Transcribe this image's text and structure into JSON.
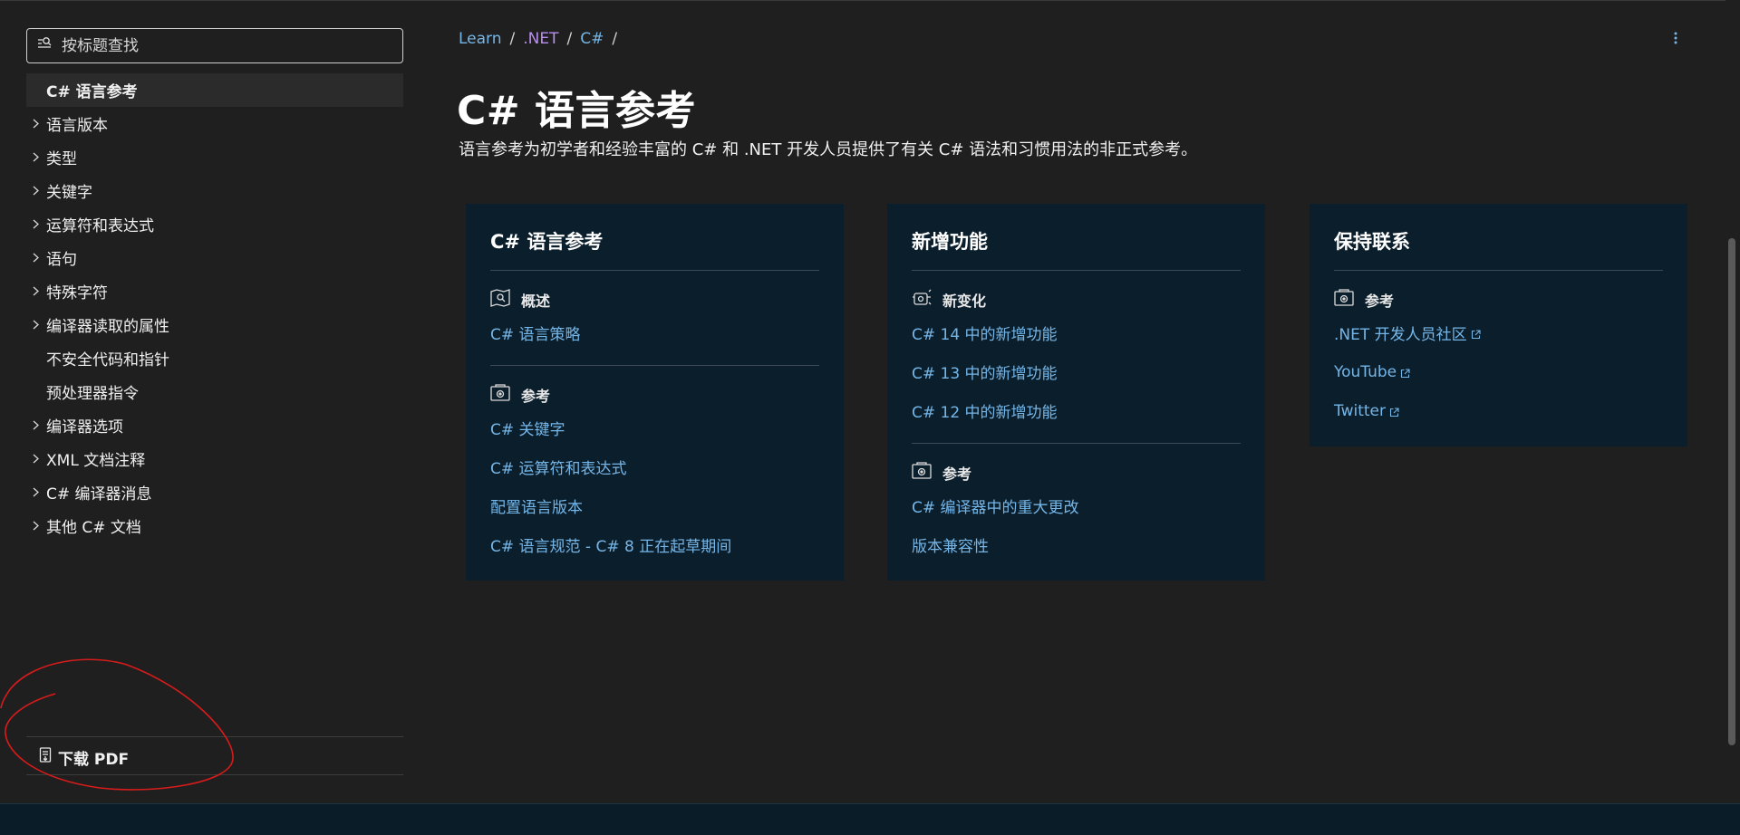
{
  "sidebar": {
    "filter_placeholder": "按标题查找",
    "items": [
      {
        "label": "C# 语言参考",
        "expandable": false,
        "active": true
      },
      {
        "label": "语言版本",
        "expandable": true
      },
      {
        "label": "类型",
        "expandable": true
      },
      {
        "label": "关键字",
        "expandable": true
      },
      {
        "label": "运算符和表达式",
        "expandable": true
      },
      {
        "label": "语句",
        "expandable": true
      },
      {
        "label": "特殊字符",
        "expandable": true
      },
      {
        "label": "编译器读取的属性",
        "expandable": true
      },
      {
        "label": "不安全代码和指针",
        "expandable": false
      },
      {
        "label": "预处理器指令",
        "expandable": false
      },
      {
        "label": "编译器选项",
        "expandable": true
      },
      {
        "label": "XML 文档注释",
        "expandable": true
      },
      {
        "label": "C# 编译器消息",
        "expandable": true
      },
      {
        "label": "其他 C# 文档",
        "expandable": true
      }
    ],
    "download_pdf": "下载 PDF"
  },
  "breadcrumb": [
    {
      "label": "Learn",
      "visited": false
    },
    {
      "label": ".NET",
      "visited": true
    },
    {
      "label": "C#",
      "visited": false
    }
  ],
  "page": {
    "title": "C# 语言参考",
    "description": "语言参考为初学者和经验丰富的 C# 和 .NET 开发人员提供了有关 C# 语法和习惯用法的非正式参考。"
  },
  "cards": [
    {
      "title": "C# 语言参考",
      "sections": [
        {
          "heading": "概述",
          "icon": "overview-icon",
          "links": [
            {
              "label": "C# 语言策略",
              "external": false
            }
          ]
        },
        {
          "heading": "参考",
          "icon": "reference-icon",
          "links": [
            {
              "label": "C# 关键字",
              "external": false
            },
            {
              "label": "C# 运算符和表达式",
              "external": false
            },
            {
              "label": "配置语言版本",
              "external": false
            },
            {
              "label": "C# 语言规范 - C# 8 正在起草期间",
              "external": false
            }
          ]
        }
      ]
    },
    {
      "title": "新增功能",
      "sections": [
        {
          "heading": "新变化",
          "icon": "whats-new-icon",
          "links": [
            {
              "label": "C# 14 中的新增功能",
              "external": false
            },
            {
              "label": "C# 13 中的新增功能",
              "external": false
            },
            {
              "label": "C# 12 中的新增功能",
              "external": false
            }
          ]
        },
        {
          "heading": "参考",
          "icon": "reference-icon",
          "links": [
            {
              "label": "C# 编译器中的重大更改",
              "external": false
            },
            {
              "label": "版本兼容性",
              "external": false
            }
          ]
        }
      ]
    },
    {
      "title": "保持联系",
      "sections": [
        {
          "heading": "参考",
          "icon": "reference-icon",
          "links": [
            {
              "label": ".NET 开发人员社区",
              "external": true
            },
            {
              "label": "YouTube",
              "external": true
            },
            {
              "label": "Twitter",
              "external": true
            }
          ]
        }
      ]
    }
  ],
  "colors": {
    "background": "#1f1f1f",
    "card_background": "#0b1e2c",
    "link": "#75b6e7",
    "visited_link": "#b98ef0",
    "annotation": "#d81b1b"
  }
}
